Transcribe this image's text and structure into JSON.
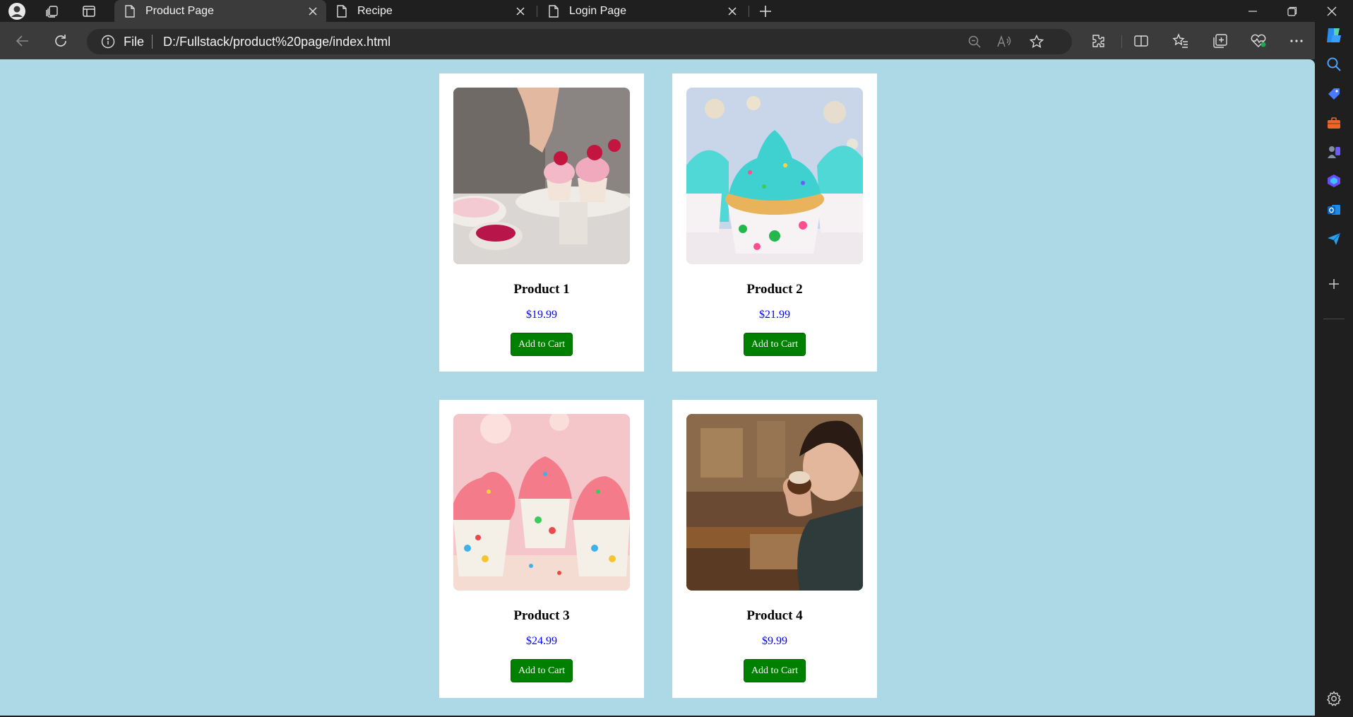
{
  "tabs": [
    {
      "label": "Product Page"
    },
    {
      "label": "Recipe"
    },
    {
      "label": "Login Page"
    }
  ],
  "address": {
    "scheme": "File",
    "url": "D:/Fullstack/product%20page/index.html"
  },
  "products": [
    {
      "name": "Product 1",
      "price": "$19.99",
      "button": "Add to Cart"
    },
    {
      "name": "Product 2",
      "price": "$21.99",
      "button": "Add to Cart"
    },
    {
      "name": "Product 3",
      "price": "$24.99",
      "button": "Add to Cart"
    },
    {
      "name": "Product 4",
      "price": "$9.99",
      "button": "Add to Cart"
    }
  ],
  "colors": {
    "page_background": "#add8e6",
    "button_green": "#008000",
    "price_blue": "#0000ff",
    "browser_dark": "#1f1f1f",
    "toolbar": "#3b3b3b"
  }
}
